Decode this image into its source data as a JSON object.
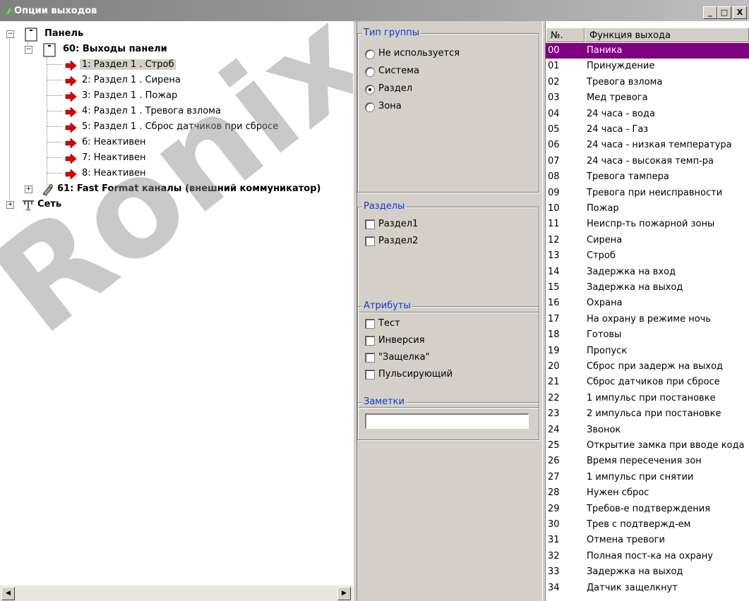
{
  "window": {
    "title": "Опции выходов",
    "buttons": {
      "minimize": "_",
      "maximize": "□",
      "close": "X"
    }
  },
  "tree": {
    "root": {
      "label": "Панель",
      "expander": "−"
    },
    "group": {
      "label": "60: Выходы панели",
      "expander": "−"
    },
    "outputs": [
      {
        "label": "1: Раздел 1 . Строб",
        "selected": true
      },
      {
        "label": "2: Раздел 1 . Сирена"
      },
      {
        "label": "3: Раздел 1 . Пожар"
      },
      {
        "label": "4: Раздел 1 . Тревога взлома"
      },
      {
        "label": "5: Раздел 1 . Сброс датчиков при сбросе"
      },
      {
        "label": "6: Неактивен"
      },
      {
        "label": "7: Неактивен"
      },
      {
        "label": "8: Неактивен"
      }
    ],
    "fast_format": {
      "label": "61: Fast Format каналы (внешний коммуникатор)",
      "expander": "+"
    },
    "network": {
      "label": "Сеть",
      "expander": "+"
    }
  },
  "group_type": {
    "legend": "Тип группы",
    "options": [
      {
        "label": "Не используется",
        "checked": false
      },
      {
        "label": "Система",
        "checked": false
      },
      {
        "label": "Раздел",
        "checked": true
      },
      {
        "label": "Зона",
        "checked": false
      }
    ]
  },
  "partitions": {
    "legend": "Разделы",
    "items": [
      {
        "label": "Раздел1"
      },
      {
        "label": "Раздел2"
      }
    ]
  },
  "attributes": {
    "legend": "Атрибуты",
    "items": [
      {
        "label": "Тест"
      },
      {
        "label": "Инверсия"
      },
      {
        "label": "\"Защелка\""
      },
      {
        "label": "Пульсирующий"
      }
    ]
  },
  "notes": {
    "legend": "Заметки",
    "value": ""
  },
  "functions": {
    "headers": {
      "num": "№.",
      "name": "Функция выхода"
    },
    "selected_color": "#800080",
    "rows": [
      {
        "num": "00",
        "name": "Паника",
        "selected": true
      },
      {
        "num": "01",
        "name": "Принуждение"
      },
      {
        "num": "02",
        "name": "Тревога взлома"
      },
      {
        "num": "03",
        "name": "Мед тревога"
      },
      {
        "num": "04",
        "name": "24 часа - вода"
      },
      {
        "num": "05",
        "name": "24 часа - Газ"
      },
      {
        "num": "06",
        "name": "24 часа - низкая температура"
      },
      {
        "num": "07",
        "name": "24 часа - высокая темп-ра"
      },
      {
        "num": "08",
        "name": "Тревога тампера"
      },
      {
        "num": "09",
        "name": "Тревога при неисправности"
      },
      {
        "num": "10",
        "name": "Пожар"
      },
      {
        "num": "11",
        "name": "Неиспр-ть пожарной зоны"
      },
      {
        "num": "12",
        "name": "Сирена"
      },
      {
        "num": "13",
        "name": "Строб"
      },
      {
        "num": "14",
        "name": "Задержка на вход"
      },
      {
        "num": "15",
        "name": "Задержка на выход"
      },
      {
        "num": "16",
        "name": "Охрана"
      },
      {
        "num": "17",
        "name": "На охрану в режиме ночь"
      },
      {
        "num": "18",
        "name": "Готовы"
      },
      {
        "num": "19",
        "name": "Пропуск"
      },
      {
        "num": "20",
        "name": "Сброс при задерж на выход"
      },
      {
        "num": "21",
        "name": "Сброс датчиков при сбросе"
      },
      {
        "num": "22",
        "name": "1 импульс при постановке"
      },
      {
        "num": "23",
        "name": "2 импульса при постановке"
      },
      {
        "num": "24",
        "name": "Звонок"
      },
      {
        "num": "25",
        "name": "Открытие замка при вводе кода"
      },
      {
        "num": "26",
        "name": "Время пересечения зон"
      },
      {
        "num": "27",
        "name": "1 импульс при снятии"
      },
      {
        "num": "28",
        "name": "Нужен сброс"
      },
      {
        "num": "29",
        "name": "Требов-е подтверждения"
      },
      {
        "num": "30",
        "name": "Трев с подтвержд-ем"
      },
      {
        "num": "31",
        "name": "Отмена тревоги"
      },
      {
        "num": "32",
        "name": "Полная пост-ка на охрану"
      },
      {
        "num": "33",
        "name": "Задержка на выход"
      },
      {
        "num": "34",
        "name": "Датчик защелкнут"
      }
    ]
  },
  "watermark": "Ronix",
  "scrollbar": {
    "left_arrow": "◀",
    "right_arrow": "▶"
  }
}
